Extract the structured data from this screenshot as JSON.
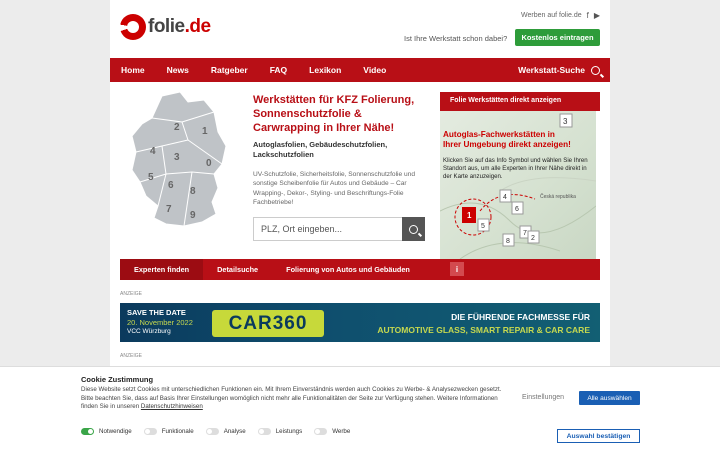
{
  "header": {
    "logo_prefix": "folie",
    "logo_suffix": ".de",
    "werben_link": "Werben auf folie.de",
    "question": "Ist Ihre Werkstatt schon dabei?",
    "cta": "Kostenlos eintragen",
    "social_icons": [
      "facebook-icon",
      "youtube-icon"
    ]
  },
  "nav": {
    "items": [
      "Home",
      "News",
      "Ratgeber",
      "FAQ",
      "Lexikon",
      "Video"
    ],
    "right": "Werkstatt-Suche"
  },
  "hero": {
    "map_numbers": [
      "2",
      "1",
      "4",
      "3",
      "0",
      "5",
      "6",
      "7",
      "8",
      "9"
    ],
    "headline": "Werkstätten für KFZ Folierung, Sonnenschutzfolie & Carwrapping in Ihrer Nähe!",
    "subheadline": "Autoglasfolien, Gebäudeschutzfolien, Lackschutzfolien",
    "description": "UV-Schutzfolie, Sicherheitsfolie, Sonnenschutzfolie und sonstige Scheibenfolie für Autos und Gebäude – Car Wrapping-, Dekor-, Styling- und Beschriftungs-Folie Fachbetriebe!",
    "search_placeholder": "PLZ, Ort eingeben..."
  },
  "panel": {
    "head": "Folie Werkstätten direkt anzeigen",
    "title": "Autoglas-Fachwerkstätten in Ihrer Umgebung direkt anzeigen!",
    "text": "Klicken Sie auf das Info Symbol und wählen Sie Ihren Standort aus, um alle Experten in Ihrer Nähe direkt in der Karte anzuzeigen.",
    "markers": [
      "3",
      "4",
      "6",
      "1",
      "5",
      "7",
      "8",
      "2"
    ],
    "places": [
      "Česká republika"
    ]
  },
  "tabs": {
    "items": [
      "Experten finden",
      "Detailsuche",
      "Folierung von Autos und Gebäuden"
    ],
    "active": 0,
    "info": "i"
  },
  "ad": {
    "label": "ANZEIGE",
    "save": "SAVE THE DATE",
    "date": "20. November 2022",
    "venue": "VCC Würzburg",
    "brand": "CAR360",
    "right1": "DIE FÜHRENDE FACHMESSE FÜR",
    "right2": "AUTOMOTIVE GLASS, SMART REPAIR & CAR CARE",
    "label2": "ANZEIGE"
  },
  "cookie": {
    "title": "Cookie Zustimmung",
    "text": "Diese Website setzt Cookies mit unterschiedlichen Funktionen ein. Mit Ihrem Einverständnis werden auch Cookies zu Werbe- & Analysezwecken gesetzt. Bitte beachten Sie, dass auf Basis Ihrer Einstellungen womöglich nicht mehr alle Funktionalitäten der Seite zur Verfügung stehen. Weitere Informationen finden Sie in unseren",
    "link": "Datenschutzhinweisen",
    "settings": "Einstellungen",
    "select_all": "Alle auswählen",
    "confirm": "Auswahl bestätigen",
    "toggles": [
      {
        "label": "Notwendige",
        "on": true
      },
      {
        "label": "Funktionale",
        "on": false
      },
      {
        "label": "Analyse",
        "on": false
      },
      {
        "label": "Leistungs",
        "on": false
      },
      {
        "label": "Werbe",
        "on": false
      }
    ]
  }
}
